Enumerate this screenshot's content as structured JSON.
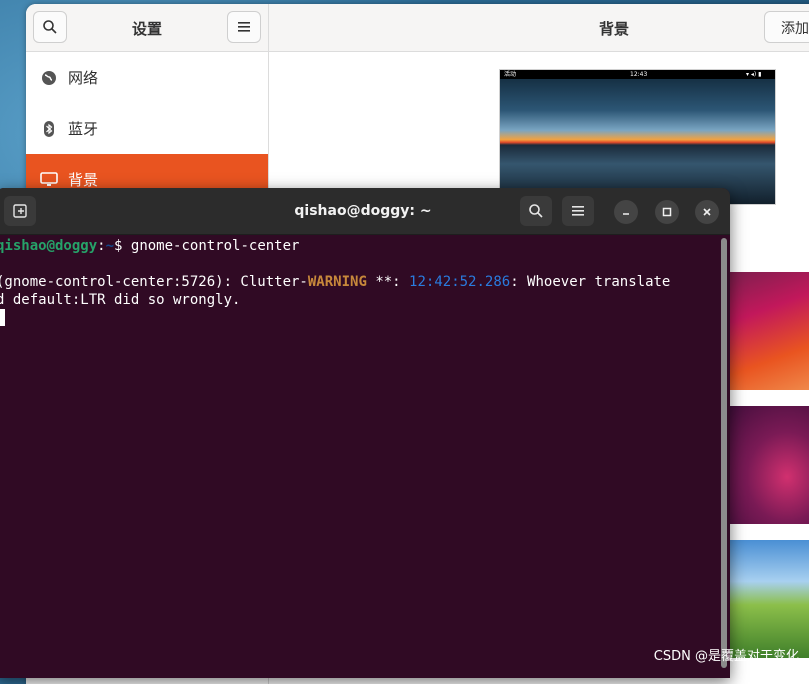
{
  "settings": {
    "sidebar_title": "设置",
    "main_title": "背景",
    "add_button": "添加",
    "sidebar_items": [
      {
        "label": "网络",
        "icon": "globe-icon"
      },
      {
        "label": "蓝牙",
        "icon": "bluetooth-icon"
      },
      {
        "label": "背景",
        "icon": "display-icon",
        "active": true
      }
    ],
    "preview_bar": {
      "left": "活动",
      "center": "12:43"
    }
  },
  "terminal": {
    "title": "qishao@doggy: ~",
    "prompt_user": "qishao@doggy",
    "prompt_sep": ":",
    "prompt_path": "~",
    "prompt_dollar": "$ ",
    "command": "gnome-control-center",
    "warn_prefix": "(gnome-control-center:5726): Clutter-",
    "warn_word": "WARNING",
    "warn_mid": " **: ",
    "warn_time": "12:42:52.286",
    "warn_tail": ": Whoever translate",
    "line3": "d default:LTR did so wrongly."
  },
  "watermark": "CSDN @是覆盖对于变化",
  "colors": {
    "accent": "#e95420",
    "terminal_bg": "#300a24",
    "prompt_user": "#26a269",
    "warning": "#c7883b",
    "timestamp": "#2a7bde"
  }
}
